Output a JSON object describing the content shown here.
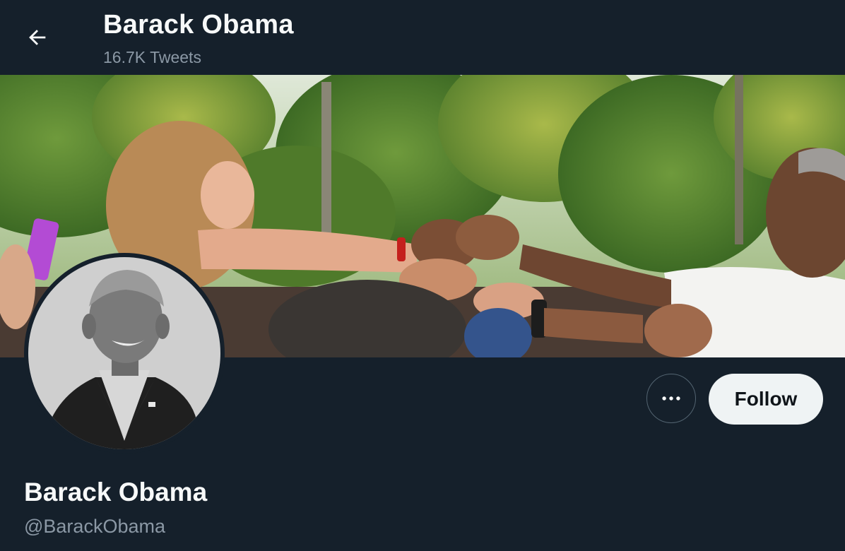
{
  "header": {
    "title": "Barack Obama",
    "tweet_count": "16.7K Tweets",
    "back_icon": "arrow-left-icon"
  },
  "banner": {
    "description_icon": "banner-photo"
  },
  "avatar": {
    "icon": "profile-photo"
  },
  "actions": {
    "more_icon": "more-horizontal-icon",
    "follow_label": "Follow"
  },
  "profile": {
    "name": "Barack Obama",
    "handle": "@BarackObama"
  },
  "colors": {
    "background": "#15202b",
    "primary_text": "#f7f9f9",
    "secondary_text": "#8b98a5",
    "follow_button_bg": "#eff3f4",
    "follow_button_text": "#0f1419",
    "border": "#536471"
  }
}
